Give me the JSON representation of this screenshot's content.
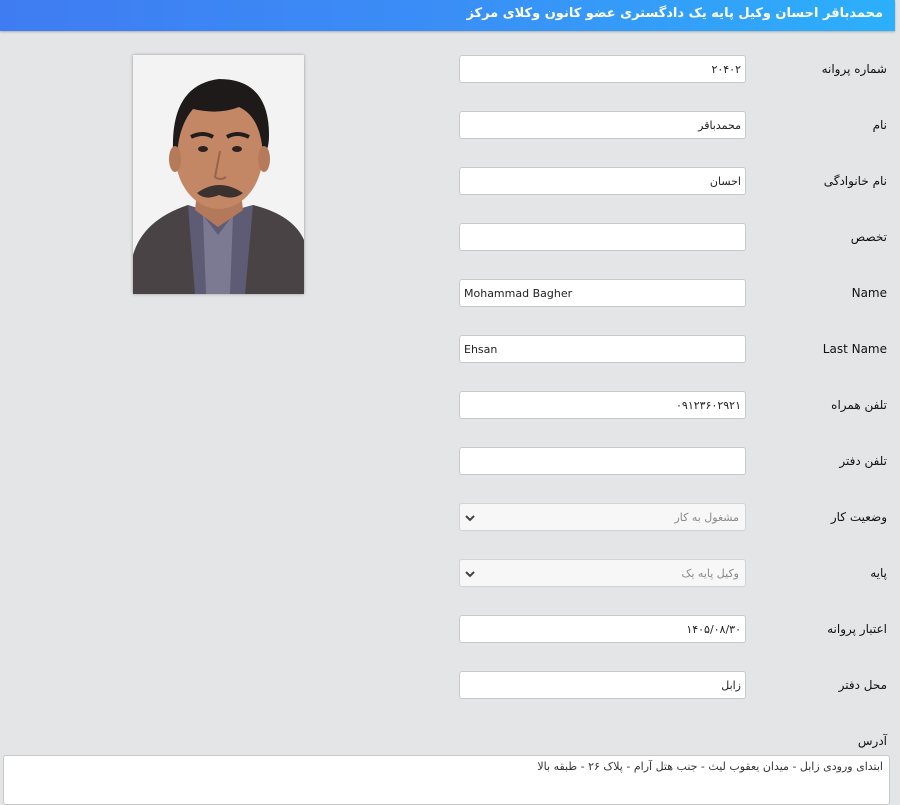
{
  "header": {
    "title": "محمدباقر احسان وکیل پایه یک دادگستری عضو کانون وکلای مرکز"
  },
  "form": {
    "license_number": {
      "label": "شماره پروانه",
      "value": "۲۰۴۰۲"
    },
    "first_name": {
      "label": "نام",
      "value": "محمدباقر"
    },
    "last_name": {
      "label": "نام خانوادگی",
      "value": "احسان"
    },
    "specialty": {
      "label": "تخصص",
      "value": ""
    },
    "name_en": {
      "label": "Name",
      "value": "Mohammad Bagher"
    },
    "last_name_en": {
      "label": "Last Name",
      "value": "Ehsan"
    },
    "mobile": {
      "label": "تلفن همراه",
      "value": "۰۹۱۲۳۶۰۲۹۲۱"
    },
    "office_phone": {
      "label": "تلفن دفتر",
      "value": ""
    },
    "work_status": {
      "label": "وضعیت کار",
      "value": "مشغول به کار"
    },
    "grade": {
      "label": "پایه",
      "value": "وکیل پایه یک"
    },
    "license_validity": {
      "label": "اعتبار پروانه",
      "value": "۱۴۰۵/۰۸/۳۰"
    },
    "office_location": {
      "label": "محل دفتر",
      "value": "زابل"
    },
    "address": {
      "label": "آدرس",
      "value": "ابتدای ورودی زابل - میدان یعقوب لیث - جنب هتل آرام - پلاک ۲۶ - طبقه بالا"
    }
  },
  "colors": {
    "header_start": "#3f7cf2",
    "header_end": "#2cb0fb",
    "background": "#e4e5e6"
  }
}
